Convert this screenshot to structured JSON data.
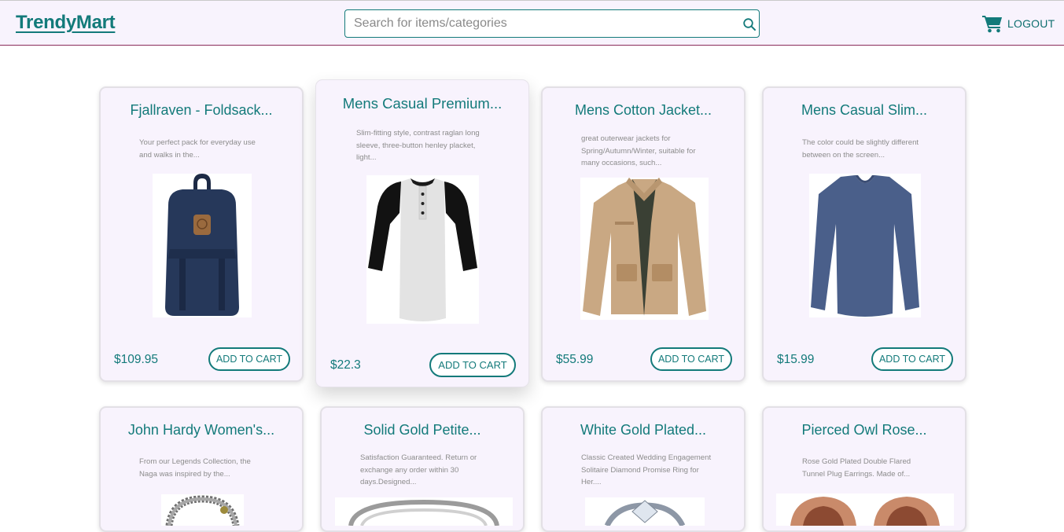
{
  "header": {
    "brand": "TrendyMart",
    "search_placeholder": "Search for items/categories",
    "logout_label": "LOGOUT"
  },
  "products": [
    {
      "title": "Fjallraven - Foldsack...",
      "description": "Your perfect pack for everyday use and walks in the...",
      "price": "$109.95",
      "button": "ADD TO CART",
      "image": "navy-backpack"
    },
    {
      "title": "Mens Casual Premium...",
      "description": "Slim-fitting style, contrast raglan long sleeve, three-button henley placket, light...",
      "price": "$22.3",
      "button": "ADD TO CART",
      "image": "raglan-henley-shirt"
    },
    {
      "title": "Mens Cotton Jacket...",
      "description": "great outerwear jackets for Spring/Autumn/Winter, suitable for many occasions, such...",
      "price": "$55.99",
      "button": "ADD TO CART",
      "image": "khaki-cotton-jacket"
    },
    {
      "title": "Mens Casual Slim...",
      "description": "The color could be slightly different between on the screen...",
      "price": "$15.99",
      "button": "ADD TO CART",
      "image": "blue-slim-tee"
    },
    {
      "title": "John Hardy Women's...",
      "description": "From our Legends Collection, the Naga was inspired by the...",
      "image": "dragon-bracelet"
    },
    {
      "title": "Solid Gold Petite...",
      "description": "Satisfaction Guaranteed. Return or exchange any order within 30 days.Designed...",
      "image": "gold-ring"
    },
    {
      "title": "White Gold Plated...",
      "description": "Classic Created Wedding Engagement Solitaire Diamond Promise Ring for Her....",
      "image": "diamond-ring"
    },
    {
      "title": "Pierced Owl Rose...",
      "description": "Rose Gold Plated Double Flared Tunnel Plug Earrings. Made of...",
      "image": "rose-gold-plugs"
    }
  ],
  "colors": {
    "accent": "#137a7a",
    "card_bg": "#f8f3fd",
    "nav_border": "#8a2b5a"
  }
}
